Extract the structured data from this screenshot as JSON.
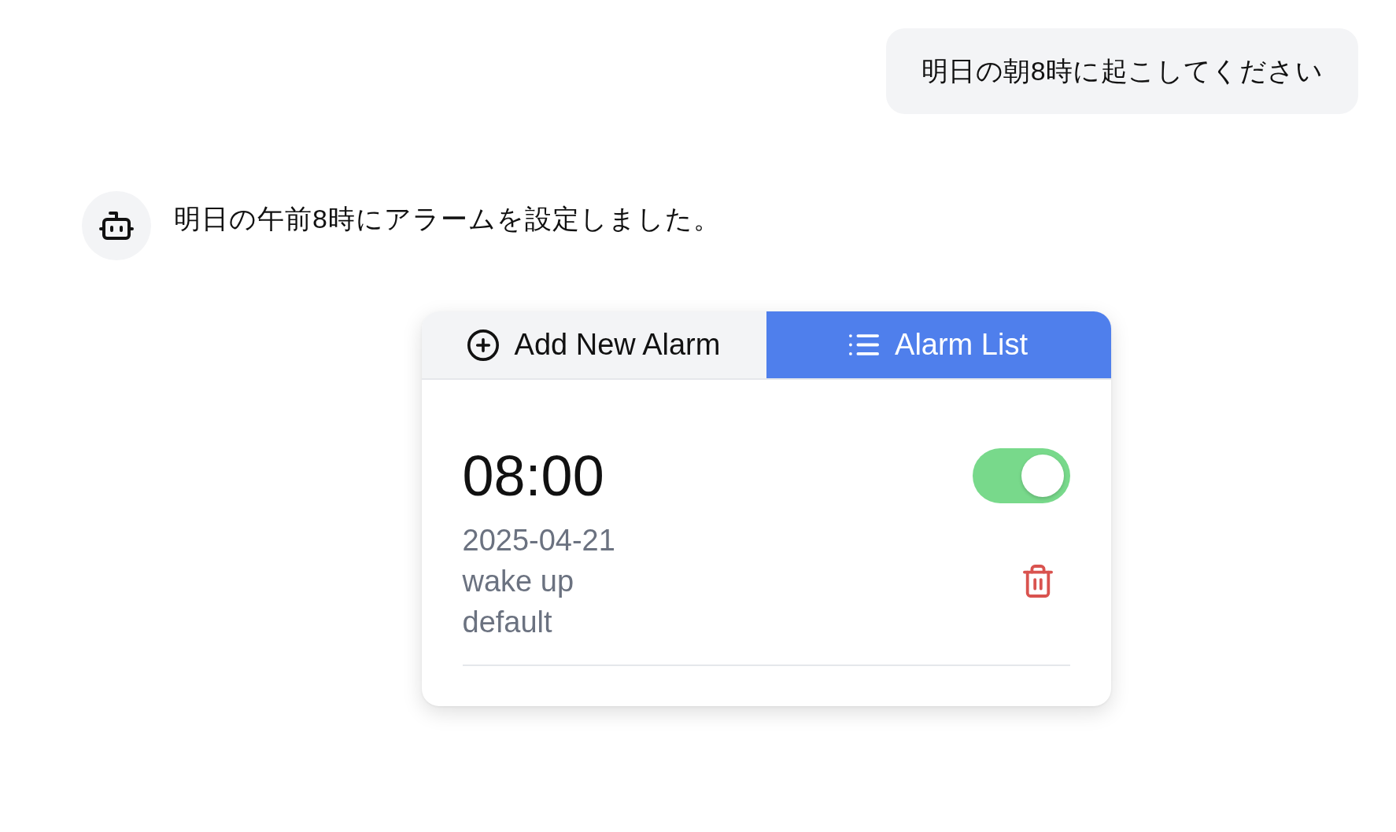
{
  "messages": [
    {
      "kind": "user",
      "text": "明日の朝8時に起こしてください"
    },
    {
      "kind": "assistant",
      "text": "明日の午前8時にアラームを設定しました。",
      "alarm_card": {
        "tabs": [
          {
            "kind": "add",
            "label": "Add New Alarm",
            "selected": false
          },
          {
            "kind": "list",
            "label": "Alarm List",
            "selected": true
          }
        ],
        "alarms": [
          {
            "time": "08:00",
            "date": "2025-04-21",
            "label": "wake up",
            "sound": "default",
            "on": true
          }
        ]
      }
    }
  ]
}
